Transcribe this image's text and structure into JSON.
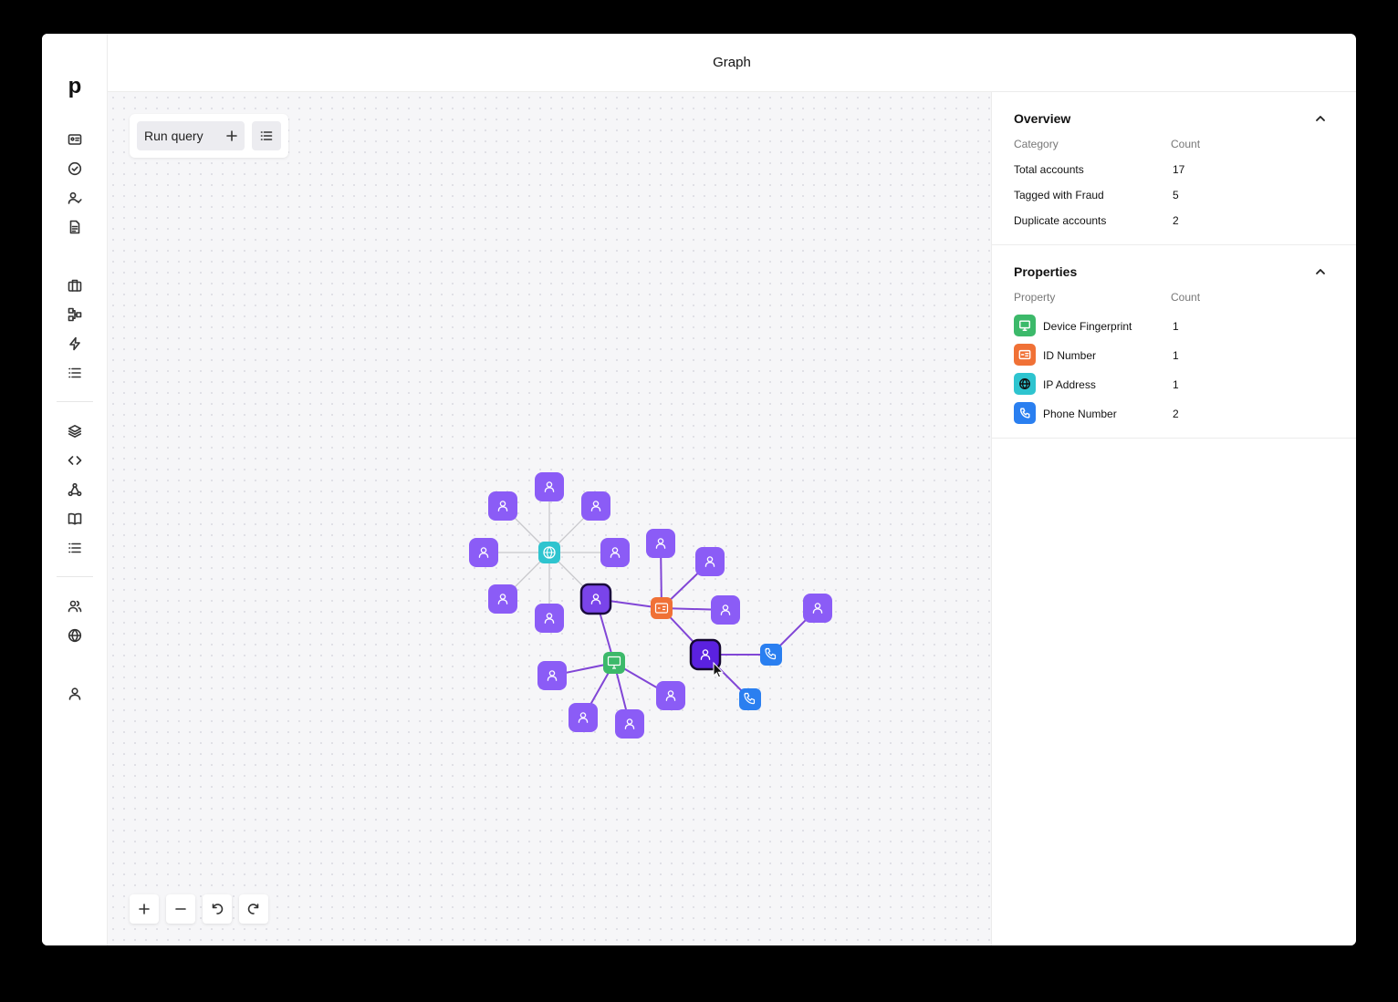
{
  "header": {
    "title": "Graph"
  },
  "nav": {
    "logo": "p",
    "items": [
      "id-card-icon",
      "check-circle-icon",
      "user-check-icon",
      "document-icon",
      "briefcase-icon",
      "flow-icon",
      "bolt-icon",
      "list-icon",
      "layers-icon",
      "code-icon",
      "graph-icon",
      "book-icon",
      "list-icon",
      "users-icon",
      "globe-icon",
      "user-icon"
    ]
  },
  "toolbar": {
    "run_label": "Run query"
  },
  "overview": {
    "title": "Overview",
    "col_category": "Category",
    "col_count": "Count",
    "rows": [
      {
        "label": "Total accounts",
        "count": "17"
      },
      {
        "label": "Tagged with Fraud",
        "count": "5"
      },
      {
        "label": "Duplicate accounts",
        "count": "2"
      }
    ]
  },
  "properties": {
    "title": "Properties",
    "col_property": "Property",
    "col_count": "Count",
    "rows": [
      {
        "label": "Device Fingerprint",
        "count": "1",
        "icon": "monitor-icon",
        "color": "#3cb96a"
      },
      {
        "label": "ID Number",
        "count": "1",
        "icon": "id-card-icon",
        "color": "#f07136"
      },
      {
        "label": "IP Address",
        "count": "1",
        "icon": "globe-icon",
        "color": "#2ec4cf"
      },
      {
        "label": "Phone Number",
        "count": "2",
        "icon": "phone-icon",
        "color": "#2a7ff0"
      }
    ]
  },
  "colors": {
    "account": "#8b5cf6",
    "account_highlight": "#6d28d9",
    "edge_light": "#c8c8cc",
    "edge_strong": "#8146d6"
  }
}
